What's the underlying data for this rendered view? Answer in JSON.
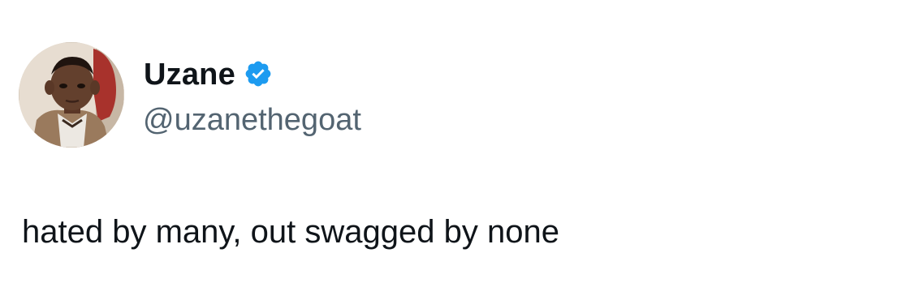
{
  "tweet": {
    "author": {
      "display_name": "Uzane",
      "handle": "@uzanethegoat",
      "verified_badge_icon": "verified-check-icon",
      "verified_color": "#1d9bf0"
    },
    "text": "hated by many, out swagged by none"
  }
}
